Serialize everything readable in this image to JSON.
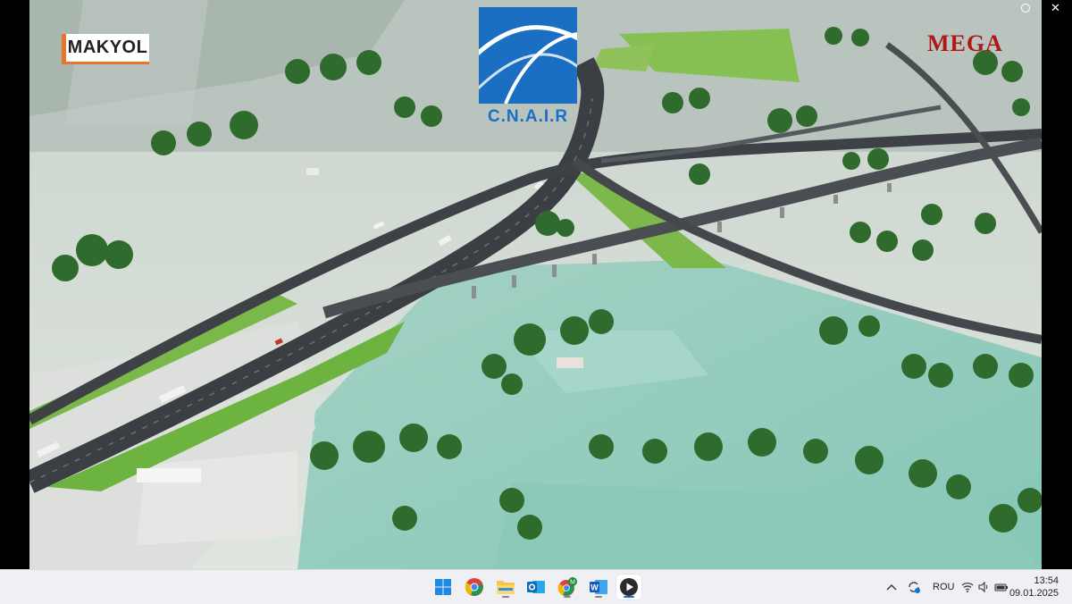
{
  "video": {
    "logo_left": "MAKYOL",
    "logo_center": "C.N.A.I.R",
    "logo_right": "MEGA"
  },
  "window_controls": {
    "close_icon": "close-icon",
    "dot_icon": "dot-icon"
  },
  "taskbar": {
    "apps": [
      {
        "name": "windows-start-icon",
        "active": false
      },
      {
        "name": "chrome-icon",
        "active": false
      },
      {
        "name": "file-explorer-icon",
        "active": false
      },
      {
        "name": "outlook-icon",
        "active": false
      },
      {
        "name": "chrome-profile-icon",
        "active": false
      },
      {
        "name": "word-icon",
        "active": false
      },
      {
        "name": "media-player-icon",
        "active": true
      }
    ],
    "tray": {
      "language": "ROU",
      "chevron_icon": "chevron-up-icon",
      "sync_icon": "sync-icon",
      "wifi_icon": "wifi-icon",
      "volume_icon": "volume-icon",
      "battery_icon": "battery-icon"
    },
    "time": "13:54",
    "date": "09.01.2025"
  },
  "colors": {
    "cnair_blue": "#1a6fc2",
    "makyol_orange": "#e8742a",
    "mega_red": "#b01818",
    "taskbar_bg": "#eef0f4",
    "active_indicator": "#1a6fd6"
  }
}
